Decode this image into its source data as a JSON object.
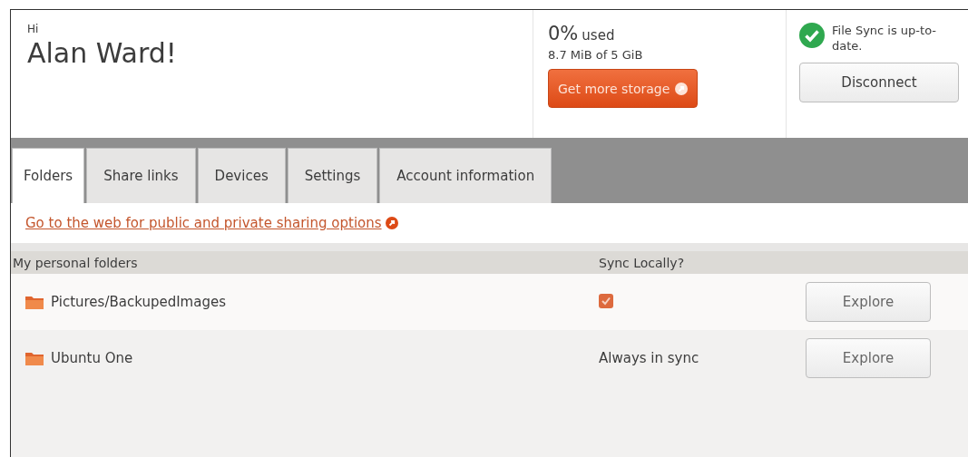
{
  "greeting": {
    "hi": "Hi",
    "name": "Alan Ward!"
  },
  "storage": {
    "percent": "0%",
    "percent_label": "used",
    "amount": "8.7 MiB of 5 GiB",
    "button": "Get more storage"
  },
  "sync": {
    "status": "File Sync is up-to-date.",
    "button": "Disconnect"
  },
  "tabs": [
    {
      "label": "Folders",
      "selected": true
    },
    {
      "label": "Share links",
      "selected": false
    },
    {
      "label": "Devices",
      "selected": false
    },
    {
      "label": "Settings",
      "selected": false
    },
    {
      "label": "Account information",
      "selected": false
    }
  ],
  "web_link": "Go to the web for public and private sharing options",
  "table": {
    "columns": [
      "My personal folders",
      "Sync Locally?"
    ],
    "rows": [
      {
        "name": "Pictures/BackupedImages",
        "kind": "checkbox",
        "checked": true,
        "button": "Explore"
      },
      {
        "name": "Ubuntu One",
        "kind": "text",
        "sync_text": "Always in sync",
        "button": "Explore"
      }
    ]
  }
}
